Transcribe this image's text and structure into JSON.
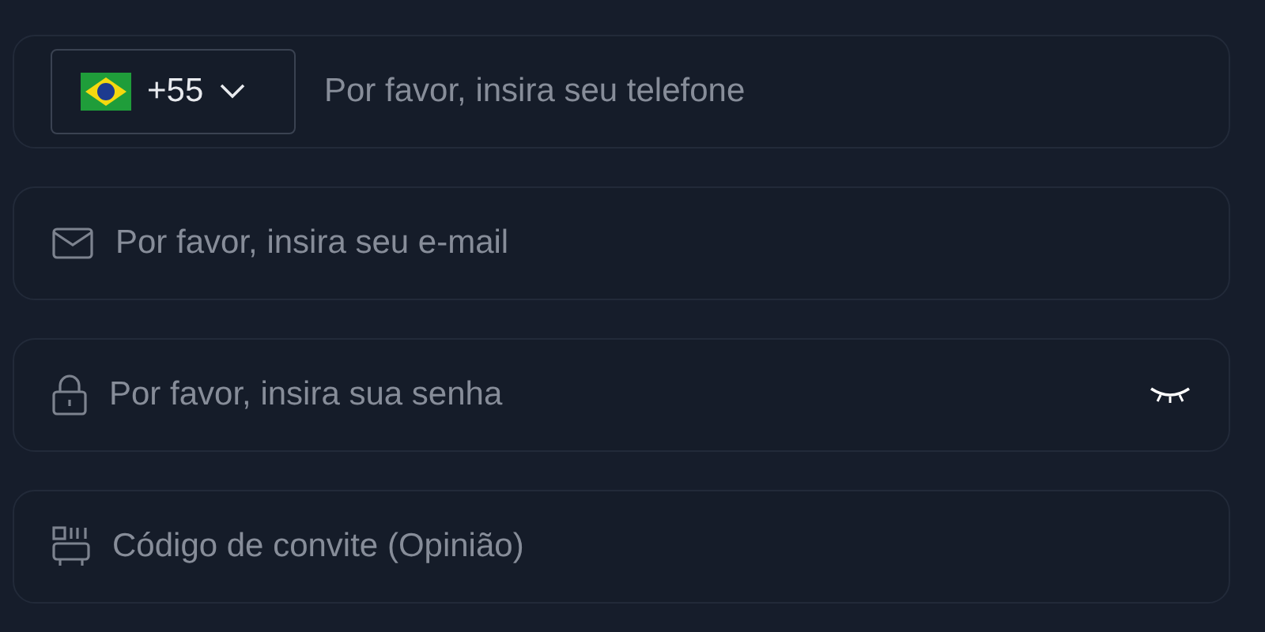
{
  "fields": [
    {
      "kind": "phone",
      "country_code": "+55",
      "placeholder": "Por favor, insira seu telefone"
    },
    {
      "kind": "email",
      "placeholder": "Por favor, insira seu e-mail"
    },
    {
      "kind": "password",
      "placeholder": "Por favor, insira sua senha"
    },
    {
      "kind": "invite",
      "placeholder": "Código de convite (Opinião)"
    }
  ]
}
